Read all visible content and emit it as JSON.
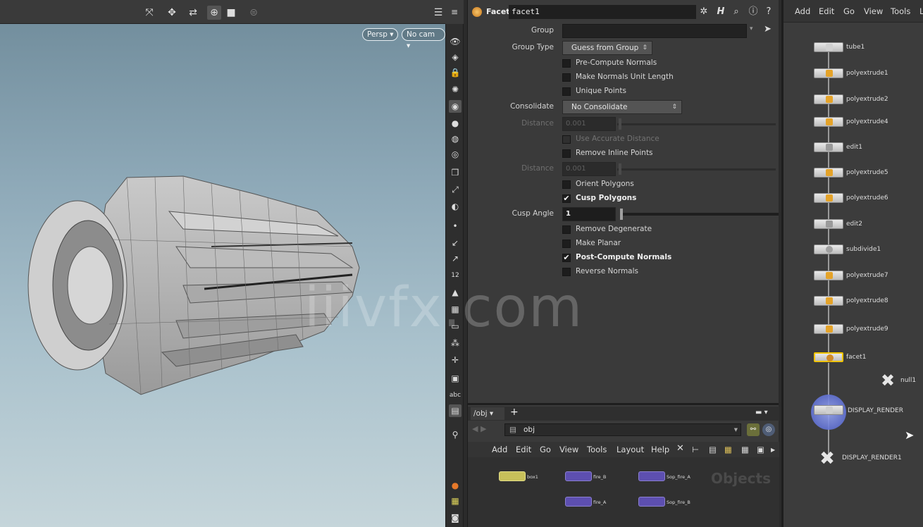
{
  "viewport": {
    "camera_menu": "Persp",
    "cam_menu": "No cam",
    "toolbar_icons": [
      "select-icon",
      "move-icon",
      "transform-icon",
      "pose-icon",
      "snap-icon",
      "disabled-icon"
    ]
  },
  "params": {
    "node_type": "Facet",
    "node_name": "facet1",
    "rows": {
      "group_label": "Group",
      "group_type_label": "Group Type",
      "group_type_value": "Guess from Group",
      "pre_compute_normals": "Pre-Compute Normals",
      "make_normals_unit": "Make Normals Unit Length",
      "unique_points": "Unique Points",
      "consolidate_label": "Consolidate",
      "consolidate_value": "No Consolidate",
      "distance_label": "Distance",
      "distance_value": "0.001",
      "use_accurate_distance": "Use Accurate Distance",
      "remove_inline_points": "Remove Inline Points",
      "distance2_label": "Distance",
      "distance2_value": "0.001",
      "orient_polygons": "Orient Polygons",
      "cusp_polygons": "Cusp Polygons",
      "cusp_angle_label": "Cusp Angle",
      "cusp_angle_value": "1",
      "remove_degenerate": "Remove Degenerate",
      "make_planar": "Make Planar",
      "post_compute_normals": "Post-Compute Normals",
      "reverse_normals": "Reverse Normals"
    },
    "checked": {
      "cusp_polygons": true,
      "post_compute_normals": true
    }
  },
  "net_bottom": {
    "tab_label": "/obj",
    "add_tab": "+",
    "path": "obj",
    "menu": [
      "Add",
      "Edit",
      "Go",
      "View",
      "Tools",
      "Layout",
      "Help"
    ],
    "watermark": "Objects",
    "nodes": [
      {
        "label": "box1"
      },
      {
        "label": "fire_B"
      },
      {
        "label": "Sop_fire_A"
      },
      {
        "label": "fire_A"
      },
      {
        "label": "Sop_fire_B"
      }
    ]
  },
  "sop": {
    "menu": [
      "Add",
      "Edit",
      "Go",
      "View",
      "Tools",
      "L"
    ],
    "nodes": [
      {
        "label": "tube1"
      },
      {
        "label": "polyextrude1"
      },
      {
        "label": "polyextrude2"
      },
      {
        "label": "polyextrude4"
      },
      {
        "label": "edit1"
      },
      {
        "label": "polyextrude5"
      },
      {
        "label": "polyextrude6"
      },
      {
        "label": "edit2"
      },
      {
        "label": "subdivide1"
      },
      {
        "label": "polyextrude7"
      },
      {
        "label": "polyextrude8"
      },
      {
        "label": "polyextrude9"
      },
      {
        "label": "facet1"
      }
    ],
    "null_label": "null1",
    "display_render_label": "DISPLAY_RENDER",
    "display_render1_label": "DISPLAY_RENDER1"
  },
  "watermark": "iiivfx.com",
  "colors": {
    "selected_node": "#f0c400",
    "object_node": "#5d4fb0",
    "sop_glyph": "#e4a32a"
  }
}
